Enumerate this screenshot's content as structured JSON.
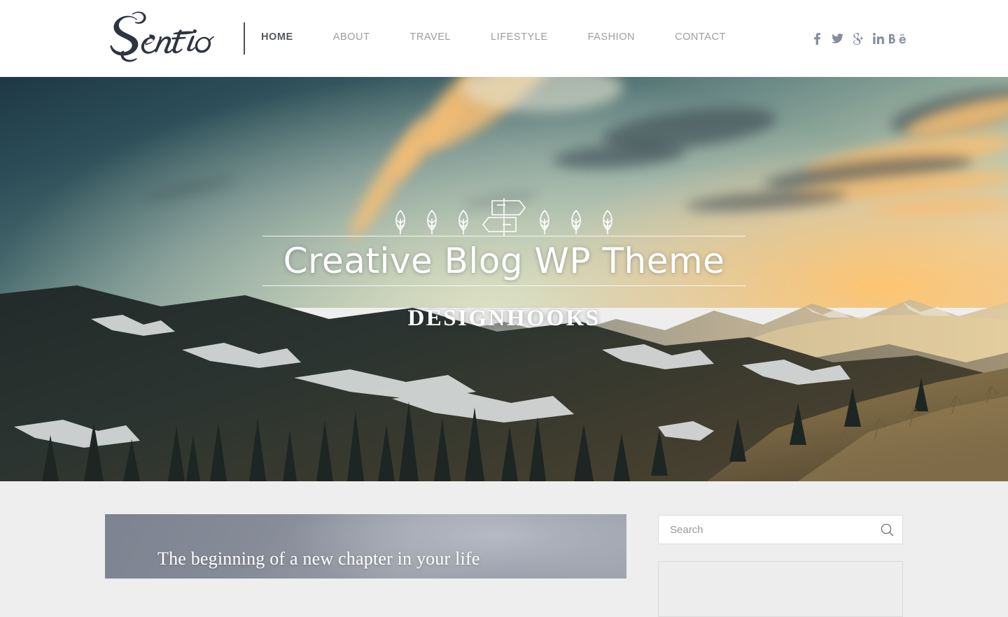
{
  "site": {
    "brand": "Sentio",
    "brand_tagline": ""
  },
  "header": {
    "nav": [
      {
        "label": "HOME",
        "active": true
      },
      {
        "label": "ABOUT",
        "active": false
      },
      {
        "label": "TRAVEL",
        "active": false
      },
      {
        "label": "LIFESTYLE",
        "active": false
      },
      {
        "label": "FASHION",
        "active": false
      },
      {
        "label": "CONTACT",
        "active": false
      }
    ],
    "social": [
      {
        "name": "facebook-icon",
        "label": "f"
      },
      {
        "name": "twitter-icon",
        "label": "t"
      },
      {
        "name": "google-plus-icon",
        "label": "g"
      },
      {
        "name": "linkedin-icon",
        "label": "in"
      },
      {
        "name": "behance-icon",
        "label": "Be"
      }
    ],
    "colors": {
      "background": "#ffffff",
      "nav_inactive": "#9d9d9d",
      "nav_active": "#55585e",
      "logo": "#2e3440",
      "social": "#858da0",
      "divider": "#4c4f56"
    }
  },
  "hero": {
    "title": "Creative Blog WP Theme",
    "subtitle": "DESIGNHOOKS",
    "ornament": "leaves-and-signpost-icon",
    "leaf_count_left": 3,
    "leaf_count_right": 3,
    "colors": {
      "text": "#ffffff",
      "rule": "rgba(255,255,255,0.85)",
      "sky_top": "#1e3844",
      "sky_mid": "#b4c3ab",
      "sky_glow": "#f0c078"
    }
  },
  "content": {
    "background": "#eeeeee",
    "post": {
      "title": "The beginning of a new chapter in your life",
      "card_color": "#8b9099"
    },
    "sidebar": {
      "search": {
        "placeholder": "Search",
        "value": "",
        "icon": "search-icon"
      },
      "widget_placeholder": ""
    }
  }
}
